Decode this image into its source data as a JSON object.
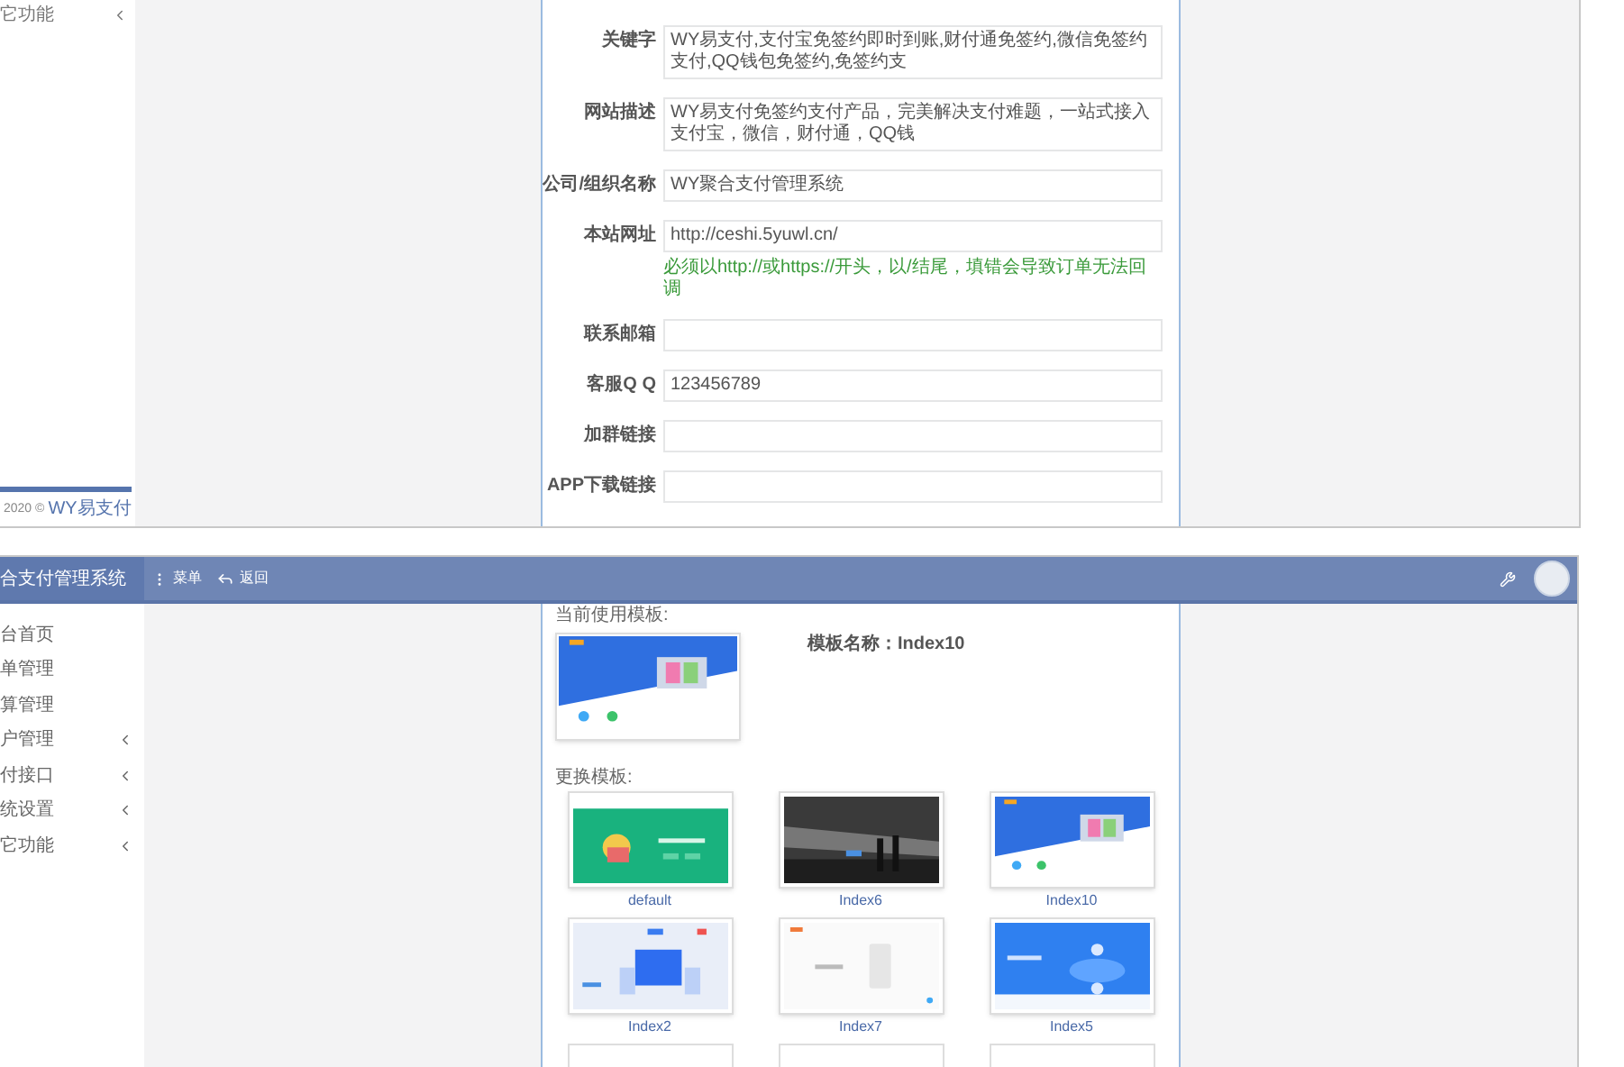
{
  "top_screen": {
    "sidebar": {
      "items": [
        {
          "label": "它功能",
          "expandable": true
        }
      ],
      "footer_year": "2020 ©",
      "footer_brand": "WY易支付"
    },
    "form": {
      "fields": [
        {
          "label": "关键字",
          "value": "WY易支付,支付宝免签约即时到账,财付通免签约,微信免签约支付,QQ钱包免签约,免签约支"
        },
        {
          "label": "网站描述",
          "value": "WY易支付免签约支付产品，完美解决支付难题，一站式接入支付宝，微信，财付通，QQ钱"
        },
        {
          "label": "公司/组织名称",
          "value": "WY聚合支付管理系统"
        },
        {
          "label": "本站网址",
          "value": "http://ceshi.5yuwl.cn/",
          "hint": "必须以http://或https://开头，以/结尾，填错会导致订单无法回调"
        },
        {
          "label": "联系邮箱"
        },
        {
          "label": "客服Q Q",
          "value": "123456789"
        },
        {
          "label": "加群链接"
        },
        {
          "label": "APP下载链接"
        }
      ]
    }
  },
  "bottom_screen": {
    "header": {
      "title": "合支付管理系统",
      "menu": "菜单",
      "back": "返回"
    },
    "sidebar": {
      "items": [
        {
          "label": "台首页",
          "expandable": false
        },
        {
          "label": "单管理",
          "expandable": false
        },
        {
          "label": "算管理",
          "expandable": false
        },
        {
          "label": "户管理",
          "expandable": true
        },
        {
          "label": "付接口",
          "expandable": true
        },
        {
          "label": "统设置",
          "expandable": true
        },
        {
          "label": "它功能",
          "expandable": true
        }
      ]
    },
    "current_template": {
      "heading": "当前使用模板:",
      "name_label": "模板名称：",
      "name": "Index10"
    },
    "change_template": {
      "heading": "更换模板:",
      "templates": [
        "default",
        "Index6",
        "Index10",
        "Index2",
        "Index7",
        "Index5"
      ]
    }
  }
}
